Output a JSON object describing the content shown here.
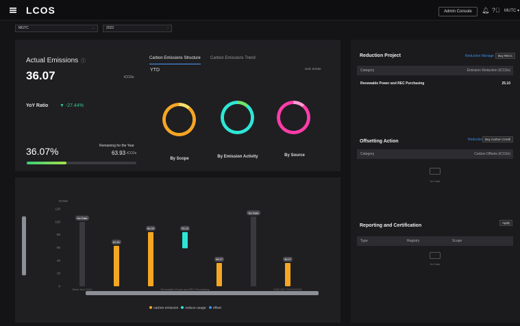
{
  "header": {
    "logo": "LCOS",
    "admin_console": "Admin Console",
    "bell_icon": "bell-icon",
    "help_icon": "help-icon",
    "user_menu": "MUTC ▾"
  },
  "filters": {
    "company": "MGTC",
    "year": "2022"
  },
  "actual_emissions": {
    "title": "Actual Emissions",
    "info_icon": "ⓘ",
    "value": "36.07",
    "unit": "tCO2e",
    "yoy_label": "YoY Ratio",
    "yoy_value": "▼ -27.44%",
    "percent": "36.07%",
    "progress_fraction": 0.3607,
    "remaining_label": "Remaining for the Year",
    "remaining_value": "63.93",
    "remaining_unit": "tCO2e"
  },
  "structure": {
    "tab_active": "Carbon Emissions Structure",
    "tab_inactive": "Carbon Emissions Trend",
    "ytd": "YTD",
    "unit": "Unit: tCO2e",
    "donuts": [
      {
        "label": "By Scope",
        "color": "#f5a623",
        "accent": "#f6e06a"
      },
      {
        "label": "By Emission Activity",
        "color": "#2ee6d6",
        "accent": "#6fe36a"
      },
      {
        "label": "By Source",
        "color": "#ff3ca8",
        "accent": "#ff9bd1"
      }
    ]
  },
  "chart_data": {
    "type": "bar",
    "ylabel": "tCO2e",
    "ylim": [
      0,
      120
    ],
    "yticks": [
      "0",
      "20",
      "40",
      "60",
      "80",
      "100",
      "120"
    ],
    "categories": [
      "Base Year 2018",
      "",
      "",
      "Renewable Power and REC Purchasing",
      "",
      "",
      "2022 NET EMISSIONS"
    ],
    "bars": [
      {
        "label": "No Data",
        "value": 100,
        "color": "#3a3a3e",
        "base": 0
      },
      {
        "label": "62.81",
        "value": 62.81,
        "color": "#f5a623",
        "base": 0
      },
      {
        "label": "84.00",
        "value": 84.0,
        "color": "#f5a623",
        "base": 0
      },
      {
        "label": "25.10",
        "value": 25.1,
        "color": "#2ee6d6",
        "base": 58.9
      },
      {
        "label": "36.07",
        "value": 36.07,
        "color": "#f5a623",
        "base": 0
      },
      {
        "label": "No Data",
        "value": 108,
        "color": "#3a3a3e",
        "base": 0
      },
      {
        "label": "36.07",
        "value": 36.07,
        "color": "#f5a623",
        "base": 0
      }
    ],
    "legend": [
      {
        "name": "carbon emission",
        "color": "#f5a623"
      },
      {
        "name": "reduce usage",
        "color": "#2ee6d6"
      },
      {
        "name": "offset",
        "color": "#3a8ee6"
      }
    ]
  },
  "reduction": {
    "title": "Reduction Project",
    "link1": "Reduction",
    "link2": "Manage",
    "button": "Buy RECs",
    "col1": "Category",
    "col2": "Emission Reduction (tCO2e)",
    "row_category": "Renewable Power and REC Purchasing",
    "row_value": "25.10"
  },
  "offsetting": {
    "title": "Offsetting Action",
    "link": "Reduction",
    "button": "Buy Carbon Credit",
    "col1": "Category",
    "col2": "Carbon Offsets (tCO2e)",
    "nodata": "No Data"
  },
  "reporting": {
    "title": "Reporting and Certification",
    "button": "Apply",
    "col1": "Type",
    "col2": "Registry",
    "col3": "Scope",
    "nodata": "No Data"
  }
}
